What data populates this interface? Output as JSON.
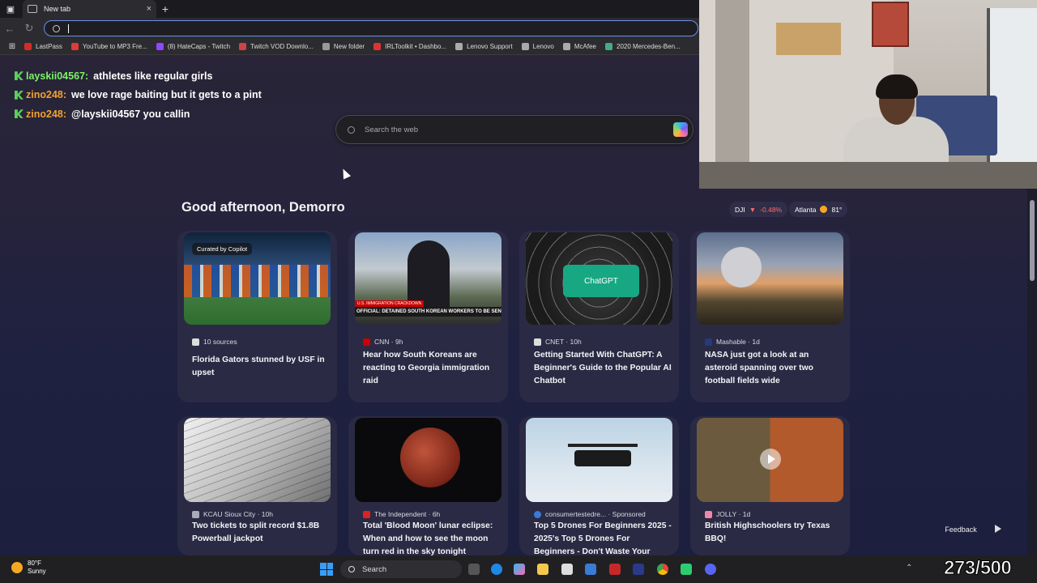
{
  "browser": {
    "tab_title": "New tab",
    "new_tab_symbol": "+",
    "close_symbol": "×",
    "address_value": "",
    "bookmarks": [
      {
        "label": "LastPass",
        "color": "#d32d27"
      },
      {
        "label": "YouTube to MP3 Fre...",
        "color": "#e03b3b"
      },
      {
        "label": "(8) HateCaps - Twitch",
        "color": "#9146ff"
      },
      {
        "label": "Twitch VOD Downlo...",
        "color": "#c44"
      },
      {
        "label": "New folder",
        "color": "#999"
      },
      {
        "label": "IRLToolkit • Dashbo...",
        "color": "#d33"
      },
      {
        "label": "Lenovo Support",
        "color": "#aaa"
      },
      {
        "label": "Lenovo",
        "color": "#aaa"
      },
      {
        "label": "McAfee",
        "color": "#aaa"
      },
      {
        "label": "2020 Mercedes-Ben...",
        "color": "#4a8"
      }
    ]
  },
  "chat": [
    {
      "user": "layskii04567",
      "color": "#7cf06a",
      "sep": ":",
      "message": "athletes like regular girls"
    },
    {
      "user": "zino248",
      "color": "#f0a330",
      "sep": ":",
      "message": "we love rage baiting but it gets to a pint"
    },
    {
      "user": "zino248",
      "color": "#f0a330",
      "sep": ":",
      "message": "@layskii04567 you callin"
    }
  ],
  "search": {
    "placeholder": "Search the web"
  },
  "greeting": "Good afternoon, Demorro",
  "market": {
    "symbol": "DJI",
    "arrow": "▼",
    "change": "-0.48%"
  },
  "weather_pill": {
    "city": "Atlanta",
    "temp": "81°"
  },
  "cards": [
    {
      "source": "10 sources",
      "title": "Florida Gators stunned by USF in upset",
      "tag": "Curated by Copilot"
    },
    {
      "source": "CNN · 9h",
      "title": "Hear how South Koreans are reacting to Georgia immigration raid",
      "banner": "OFFICIAL: DETAINED SOUTH KOREAN WORKERS TO BE SENT HOME",
      "banner_tag": "U.S. IMMIGRATION CRACKDOWN",
      "logo": "CNN"
    },
    {
      "source": "CNET · 10h",
      "title": "Getting Started With ChatGPT: A Beginner's Guide to the Popular AI Chatbot",
      "box_label": "ChatGPT"
    },
    {
      "source": "Mashable · 1d",
      "title": "NASA just got a look at an asteroid spanning over two football fields wide"
    },
    {
      "source": "KCAU Sioux City · 10h",
      "title": "Two tickets to split record $1.8B Powerball jackpot"
    },
    {
      "source": "The Independent · 6h",
      "title": "Total 'Blood Moon' lunar eclipse: When and how to see the moon turn red in the sky tonight"
    },
    {
      "source": "consumertestedre... · Sponsored",
      "title": "Top 5 Drones For Beginners 2025 - 2025's Top 5 Drones For Beginners - Don't Waste Your"
    },
    {
      "source": "JOLLY · 1d",
      "title": "British Highschoolers try Texas BBQ!"
    }
  ],
  "feedback": "Feedback",
  "taskbar": {
    "weather_temp": "80°F",
    "weather_cond": "Sunny",
    "search_label": "Search"
  },
  "counter": "273/500"
}
